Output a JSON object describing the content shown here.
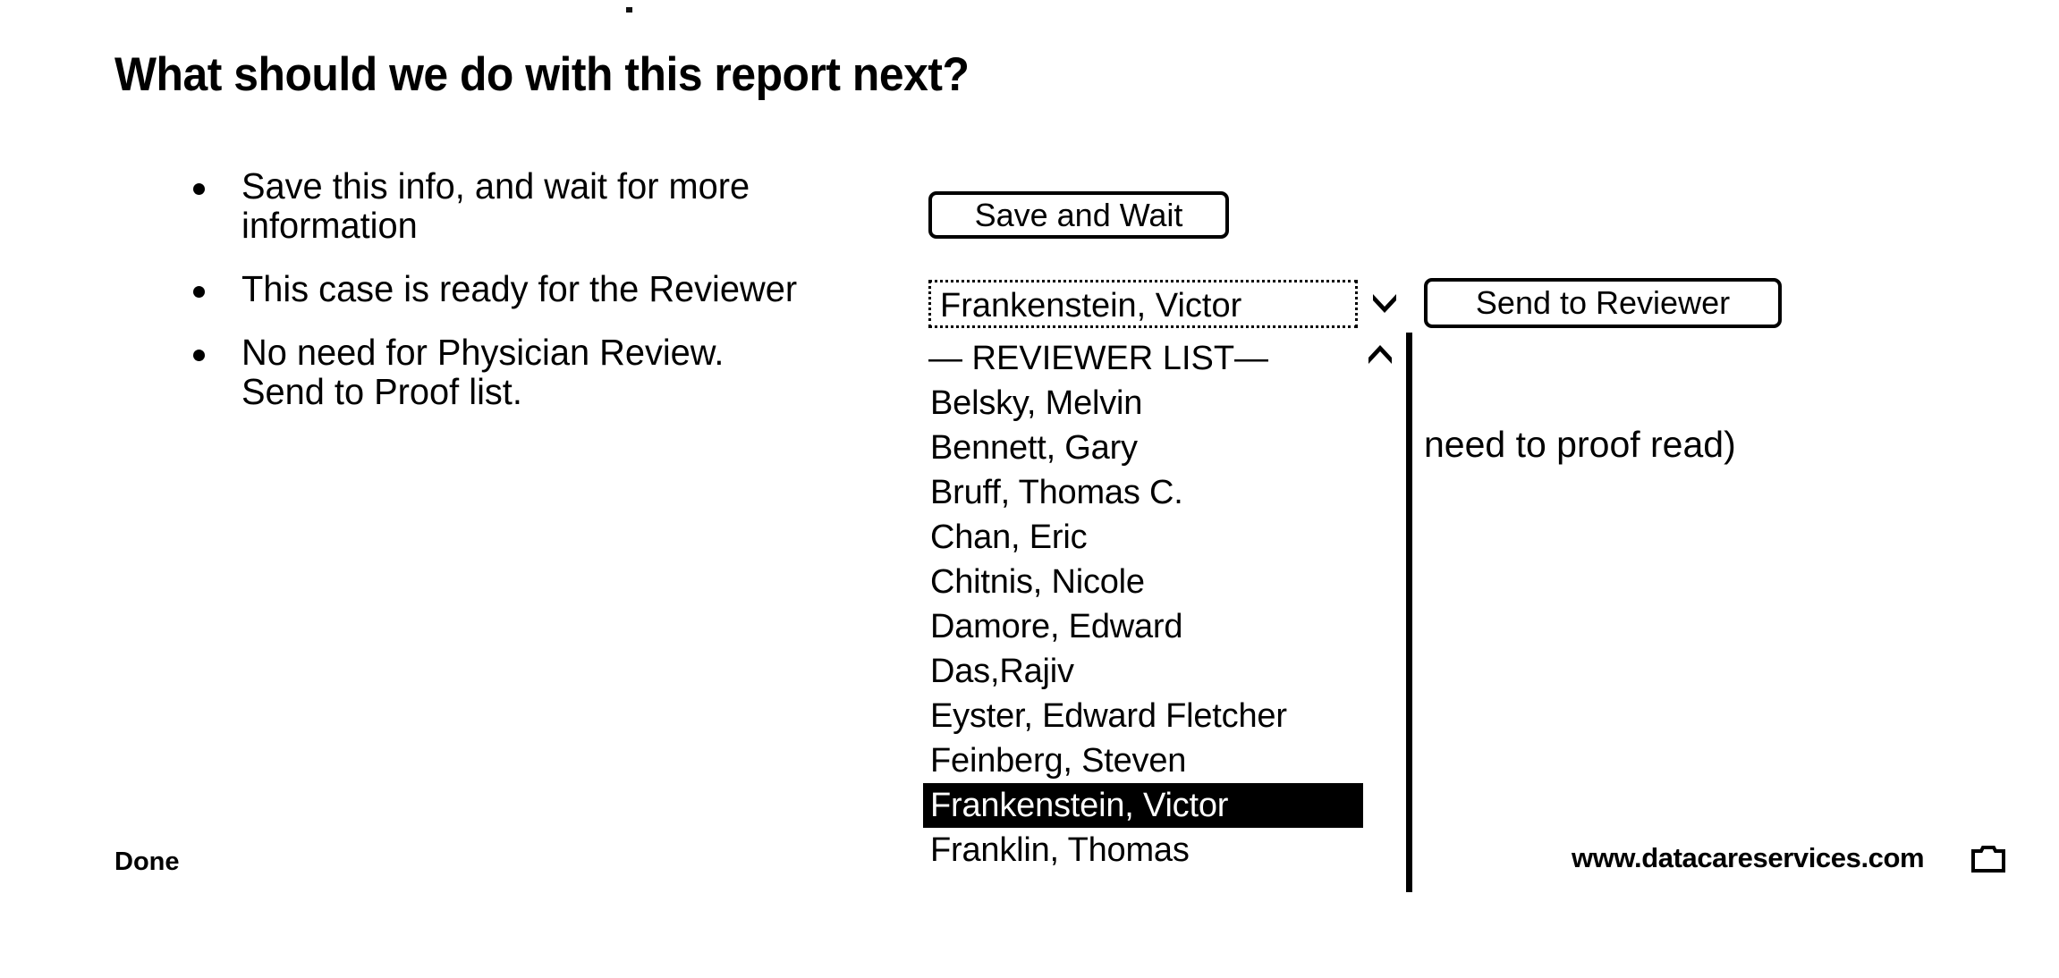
{
  "page": {
    "title": "What should we do with this report next?",
    "scan_artifact": "scan-speck"
  },
  "bullets": [
    {
      "lines": [
        "Save this info, and wait for more",
        "information"
      ]
    },
    {
      "lines": [
        "This case is ready for the Reviewer"
      ]
    },
    {
      "lines": [
        "No need for Physician Review.",
        "Send to Proof list."
      ]
    }
  ],
  "controls": {
    "save_wait_label": "Save and Wait",
    "send_reviewer_label": "Send to Reviewer",
    "proof_note": "need to proof read)"
  },
  "reviewer_select": {
    "value": "Frankenstein, Victor",
    "placeholder": "Frankenstein, Victor",
    "caret_icon": "chevron-down-icon",
    "scroll_up_icon": "chevron-up-icon",
    "selected_index": 10,
    "options": [
      "— REVIEWER LIST—",
      "Belsky, Melvin",
      "Bennett, Gary",
      "Bruff, Thomas C.",
      "Chan, Eric",
      "Chitnis, Nicole",
      "Damore, Edward",
      "Das,Rajiv",
      "Eyster, Edward Fletcher",
      "Feinberg, Steven",
      "Frankenstein, Victor",
      "Franklin, Thomas"
    ]
  },
  "statusbar": {
    "status": "Done",
    "url": "www.datacareservices.com",
    "icon": "browser-zone-icon"
  },
  "colors": {
    "ink": "#000000",
    "paper": "#ffffff",
    "selection_bg": "#000000",
    "selection_fg": "#ffffff"
  }
}
